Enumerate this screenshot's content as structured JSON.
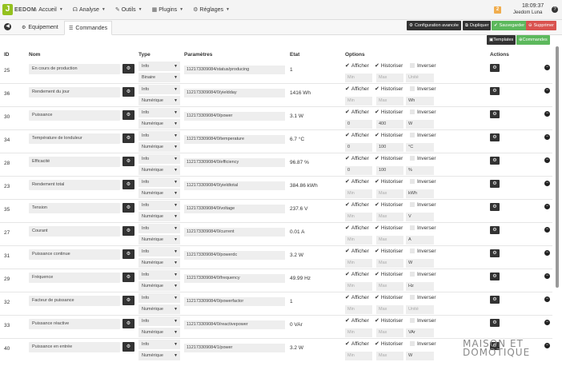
{
  "brand": {
    "logo_letter": "J",
    "logo_text": "EEDOM"
  },
  "menu": [
    {
      "icon": "⌂",
      "label": "Accueil"
    },
    {
      "icon": "☊",
      "label": "Analyse"
    },
    {
      "icon": "✎",
      "label": "Outils"
    },
    {
      "icon": "▦",
      "label": "Plugins"
    },
    {
      "icon": "⚙",
      "label": "Réglages"
    }
  ],
  "header": {
    "notifications": "2",
    "time": "18:09:37",
    "user": "Jeedom Luna",
    "help": "?"
  },
  "tabs": [
    {
      "icon": "⚙",
      "label": "Equipement"
    },
    {
      "icon": "☰",
      "label": "Commandes"
    }
  ],
  "actions": {
    "config": "Configuration avancée",
    "duplicate": "Dupliquer",
    "save": "Sauvegarder",
    "delete": "Supprimer",
    "templates": "Templates",
    "commands": "Commandes"
  },
  "colors": {
    "dark": "#333333",
    "green": "#5cb85c",
    "red": "#d9534f"
  },
  "table": {
    "headers": {
      "id": "ID",
      "nom": "Nom",
      "type": "Type",
      "params": "Paramètres",
      "etat": "Etat",
      "options": "Options",
      "actions": "Actions"
    },
    "option_labels": {
      "show": "Afficher",
      "historize": "Historiser",
      "invert": "Inverser"
    },
    "placeholders": {
      "min": "Min",
      "max": "Max",
      "unit": "Unité"
    },
    "rows": [
      {
        "id": "25",
        "name": "En cours de production",
        "type": "Info",
        "subtype": "Binaire",
        "param": "112173309084/status/producing",
        "state": "1",
        "min": "",
        "max": "",
        "unit": ""
      },
      {
        "id": "36",
        "name": "Rendement du jour",
        "type": "Info",
        "subtype": "Numérique",
        "param": "112173309084/0/yieldday",
        "state": "1416 Wh",
        "min": "",
        "max": "",
        "unit": "Wh"
      },
      {
        "id": "30",
        "name": "Puissance",
        "type": "Info",
        "subtype": "Numérique",
        "param": "112173309084/0/power",
        "state": "3.1 W",
        "min": "0",
        "max": "400",
        "unit": "W"
      },
      {
        "id": "34",
        "name": "Température de londuleur",
        "type": "Info",
        "subtype": "Numérique",
        "param": "112173309084/0/temperature",
        "state": "6.7 °C",
        "min": "0",
        "max": "100",
        "unit": "°C"
      },
      {
        "id": "28",
        "name": "Efficacité",
        "type": "Info",
        "subtype": "Numérique",
        "param": "112173309084/0/efficiency",
        "state": "96.87 %",
        "min": "0",
        "max": "100",
        "unit": "%"
      },
      {
        "id": "23",
        "name": "Rendement total",
        "type": "Info",
        "subtype": "Numérique",
        "param": "112173309084/0/yieldtotal",
        "state": "384.86 kWh",
        "min": "",
        "max": "",
        "unit": "kWh"
      },
      {
        "id": "35",
        "name": "Tension",
        "type": "Info",
        "subtype": "Numérique",
        "param": "112173309084/0/voltage",
        "state": "237.6 V",
        "min": "",
        "max": "",
        "unit": "V"
      },
      {
        "id": "27",
        "name": "Courant",
        "type": "Info",
        "subtype": "Numérique",
        "param": "112173309084/0/current",
        "state": "0.01 A",
        "min": "",
        "max": "",
        "unit": "A"
      },
      {
        "id": "31",
        "name": "Puissance continue",
        "type": "Info",
        "subtype": "Numérique",
        "param": "112173309084/0/powerdc",
        "state": "3.2 W",
        "min": "",
        "max": "",
        "unit": "W"
      },
      {
        "id": "29",
        "name": "Fréquence",
        "type": "Info",
        "subtype": "Numérique",
        "param": "112173309084/0/frequency",
        "state": "49.99 Hz",
        "min": "",
        "max": "",
        "unit": "Hz"
      },
      {
        "id": "32",
        "name": "Facteur de puissance",
        "type": "Info",
        "subtype": "Numérique",
        "param": "112173309084/0/powerfactor",
        "state": "1",
        "min": "",
        "max": "",
        "unit": ""
      },
      {
        "id": "33",
        "name": "Puissance réactive",
        "type": "Info",
        "subtype": "Numérique",
        "param": "112173309084/0/reactivepower",
        "state": "0 VAr",
        "min": "",
        "max": "",
        "unit": "VAr"
      },
      {
        "id": "40",
        "name": "Puissance en entrée",
        "type": "Info",
        "subtype": "Numérique",
        "param": "112173309084/1/power",
        "state": "3.2 W",
        "min": "",
        "max": "",
        "unit": "W"
      }
    ]
  },
  "watermark": {
    "line1": "MAISON ET",
    "line2": "DOMOTIQUE"
  }
}
